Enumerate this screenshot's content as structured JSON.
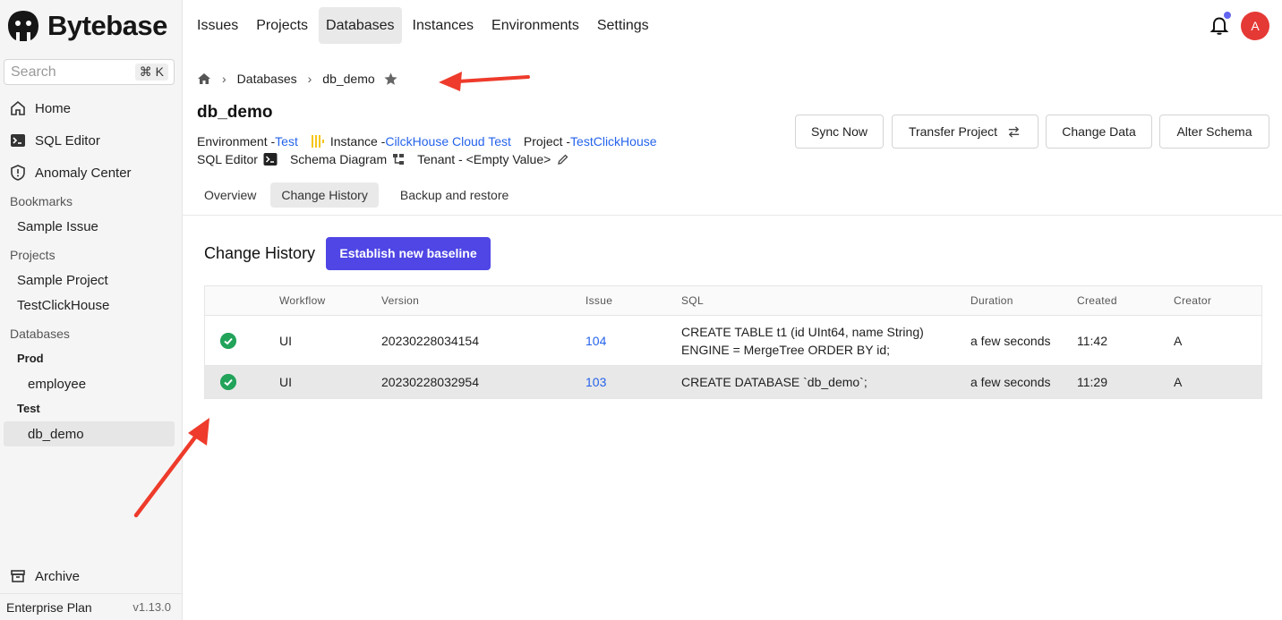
{
  "brand": {
    "name": "Bytebase"
  },
  "search": {
    "placeholder": "Search",
    "shortcut": "⌘ K"
  },
  "sidebar": {
    "items": [
      {
        "label": "Home",
        "icon": "home-icon"
      },
      {
        "label": "SQL Editor",
        "icon": "terminal-icon"
      },
      {
        "label": "Anomaly Center",
        "icon": "shield-icon"
      }
    ],
    "bookmarks_label": "Bookmarks",
    "bookmarks": [
      "Sample Issue"
    ],
    "projects_label": "Projects",
    "projects": [
      "Sample Project",
      "TestClickHouse"
    ],
    "databases_label": "Databases",
    "env_prod": "Prod",
    "prod_dbs": [
      "employee"
    ],
    "env_test": "Test",
    "test_dbs": [
      "db_demo"
    ],
    "archive": "Archive",
    "plan": "Enterprise Plan",
    "version": "v1.13.0"
  },
  "topnav": [
    "Issues",
    "Projects",
    "Databases",
    "Instances",
    "Environments",
    "Settings"
  ],
  "user": {
    "initial": "A"
  },
  "breadcrumb": {
    "parent": "Databases",
    "current": "db_demo"
  },
  "database": {
    "name": "db_demo",
    "env_label": "Environment - ",
    "env_value": "Test",
    "instance_label": "Instance - ",
    "instance_value": "CilckHouse Cloud Test",
    "project_label": "Project - ",
    "project_value": "TestClickHouse",
    "sql_editor": "SQL Editor",
    "schema_diagram": "Schema Diagram",
    "tenant": "Tenant - <Empty Value>"
  },
  "actions": {
    "sync": "Sync Now",
    "transfer": "Transfer Project",
    "change_data": "Change Data",
    "alter_schema": "Alter Schema"
  },
  "tabs": [
    "Overview",
    "Change History",
    "Backup and restore"
  ],
  "change_history": {
    "title": "Change History",
    "baseline_button": "Establish new baseline",
    "columns": [
      "Workflow",
      "Version",
      "Issue",
      "SQL",
      "Duration",
      "Created",
      "Creator"
    ],
    "rows": [
      {
        "workflow": "UI",
        "version": "20230228034154",
        "issue": "104",
        "sql_line1": "CREATE TABLE t1 (id UInt64, name String)",
        "sql_line2": "ENGINE = MergeTree ORDER BY id;",
        "duration": "a few seconds",
        "created": "11:42",
        "creator": "A"
      },
      {
        "workflow": "UI",
        "version": "20230228032954",
        "issue": "103",
        "sql_line1": "CREATE DATABASE `db_demo`;",
        "duration": "a few seconds",
        "created": "11:29",
        "creator": "A"
      }
    ]
  },
  "colors": {
    "accent": "#4f46e5",
    "link": "#2563eb",
    "success": "#22a35a",
    "avatar": "#e53935",
    "annotation": "#ee3b2b"
  }
}
